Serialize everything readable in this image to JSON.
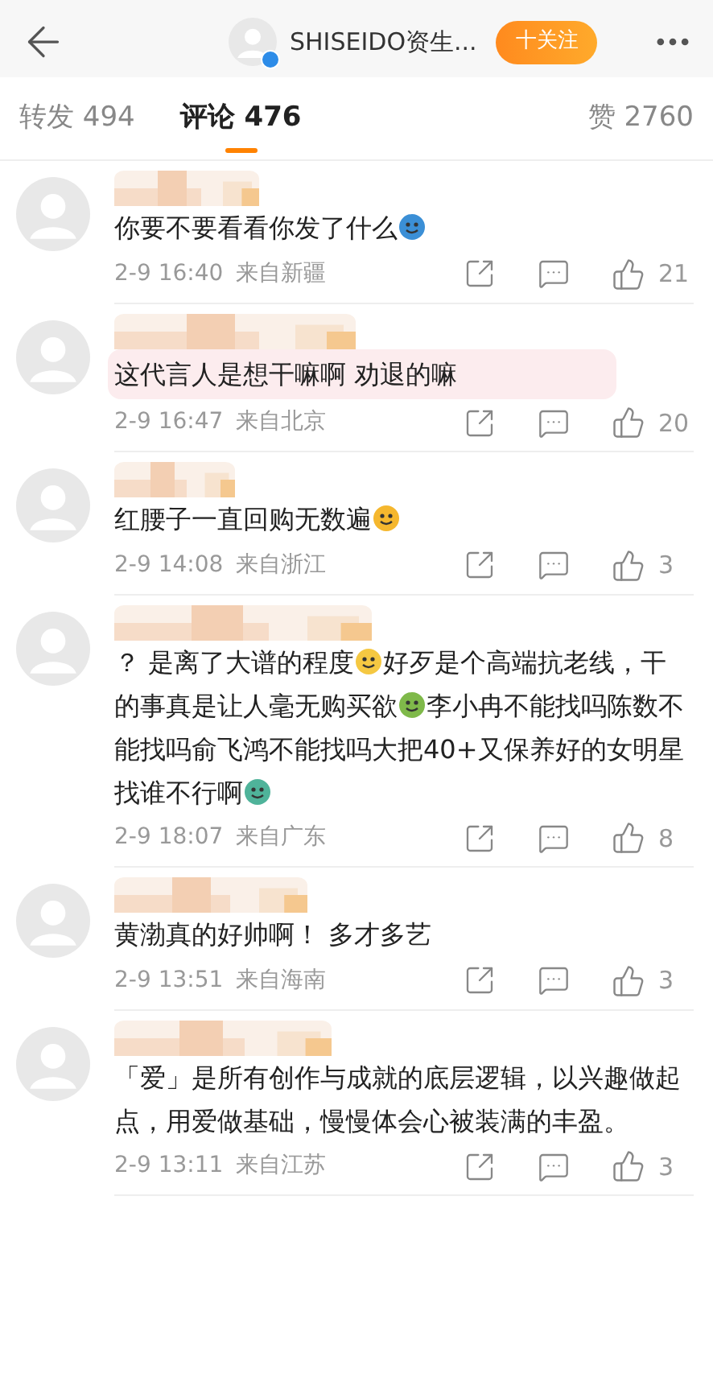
{
  "header": {
    "account": "SHISEIDO资生...",
    "verified": true,
    "follow_button": "十关注"
  },
  "tabs": [
    {
      "label": "转发 494",
      "selected": false
    },
    {
      "label": "评论 476",
      "selected": true
    },
    {
      "label": "赞 2760",
      "selected": false
    }
  ],
  "comments": [
    {
      "highlighted": false,
      "segments": [
        {
          "kind": "text",
          "text": "你要不要看看你发了什么"
        },
        {
          "kind": "emoji",
          "color": "#3b8fd6"
        }
      ],
      "time": "2-9 16:40",
      "location": "来自新疆",
      "likes": "21"
    },
    {
      "highlighted": true,
      "segments": [
        {
          "kind": "text",
          "text": "这代言人是想干嘛啊 劝退的嘛"
        }
      ],
      "time": "2-9 16:47",
      "location": "来自北京",
      "likes": "20"
    },
    {
      "highlighted": false,
      "segments": [
        {
          "kind": "text",
          "text": "红腰子一直回购无数遍"
        },
        {
          "kind": "emoji",
          "color": "#f5b72e"
        }
      ],
      "time": "2-9 14:08",
      "location": "来自浙江",
      "likes": "3"
    },
    {
      "highlighted": false,
      "segments": [
        {
          "kind": "text",
          "text": "？ 是离了大谱的程度"
        },
        {
          "kind": "emoji",
          "color": "#f5c842"
        },
        {
          "kind": "text",
          "text": "好歹是个高端抗老线，干的事真是让人毫无购买欲"
        },
        {
          "kind": "emoji",
          "color": "#7fb94a"
        },
        {
          "kind": "text",
          "text": "李小冉不能找吗陈数不能找吗俞飞鸿不能找吗大把40+又保养好的女明星找谁不行啊"
        },
        {
          "kind": "emoji",
          "color": "#4fb39a"
        }
      ],
      "time": "2-9 18:07",
      "location": "来自广东",
      "likes": "8"
    },
    {
      "highlighted": false,
      "segments": [
        {
          "kind": "text",
          "text": "黄渤真的好帅啊！ 多才多艺"
        }
      ],
      "time": "2-9 13:51",
      "location": "来自海南",
      "likes": "3"
    },
    {
      "highlighted": false,
      "segments": [
        {
          "kind": "text",
          "text": "「爱」是所有创作与成就的底层逻辑，以兴趣做起点，用爱做基础，慢慢体会心被装满的丰盈。"
        }
      ],
      "time": "2-9 13:11",
      "location": "来自江苏",
      "likes": "3"
    }
  ]
}
